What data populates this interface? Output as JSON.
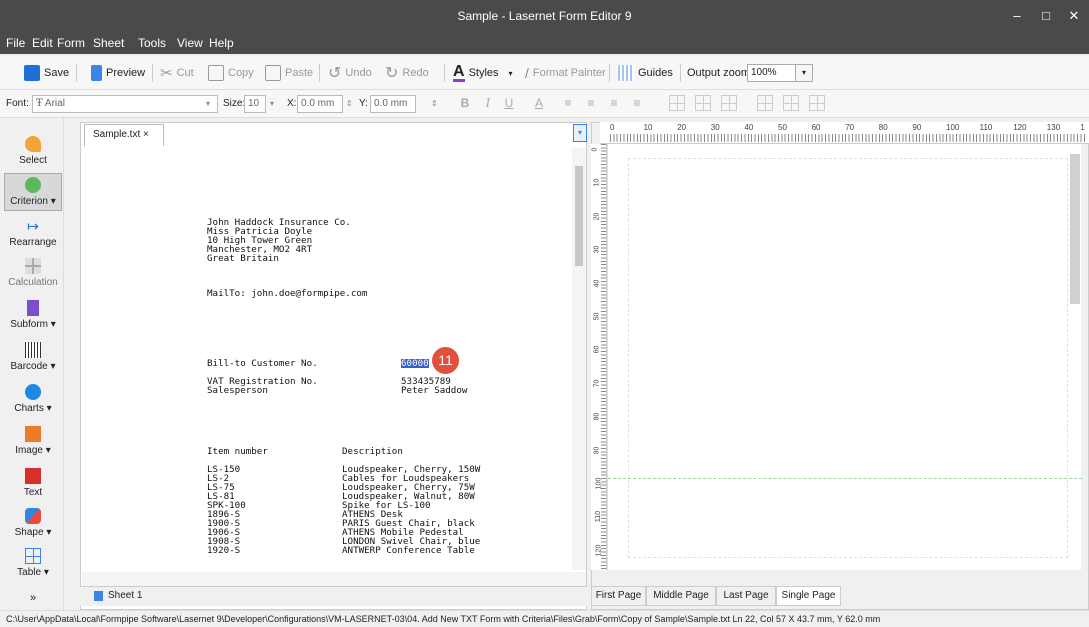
{
  "window": {
    "title": "Sample - Lasernet Form Editor 9",
    "minimize": "–",
    "maximize": "□",
    "close": "✕"
  },
  "menu": [
    "File",
    "Edit",
    "Form",
    "Sheet",
    "Tools",
    "View",
    "Help"
  ],
  "toolbar": {
    "save": "Save",
    "preview": "Preview",
    "cut": "Cut",
    "copy": "Copy",
    "paste": "Paste",
    "undo": "Undo",
    "redo": "Redo",
    "styles": "Styles",
    "format_painter": "Format Painter",
    "guides": "Guides",
    "zoom_label": "Output zoom:",
    "zoom_value": "100%"
  },
  "format_bar": {
    "font_label": "Font:",
    "font_value": "Arial",
    "size_label": "Size:",
    "size_value": "10",
    "x_label": "X:",
    "x_value": "0.0 mm",
    "y_label": "Y:",
    "y_value": "0.0 mm",
    "bold": "B",
    "italic": "I",
    "underline": "U"
  },
  "tools": [
    "Select",
    "Criterion",
    "Rearrange",
    "Calculation",
    "Subform",
    "Barcode",
    "Charts",
    "Image",
    "Text",
    "Shape",
    "Table"
  ],
  "tab": {
    "label": "Sample.txt ×"
  },
  "document": {
    "address": [
      "John Haddock Insurance Co.",
      "Miss Patricia Doyle",
      "10 High Tower Green",
      "Manchester, MO2 4RT",
      "Great Britain"
    ],
    "mailto": "MailTo: john.doe@formpipe.com",
    "billto_label": "Bill-to Customer No.",
    "billto_value": "60000",
    "vat_label": "VAT Registration No.",
    "vat_value": "533435789",
    "sales_label": "Salesperson",
    "sales_value": "Peter Saddow",
    "col_item": "Item number",
    "col_desc": "Description",
    "items": [
      {
        "no": "LS-150",
        "desc": "Loudspeaker, Cherry, 150W"
      },
      {
        "no": "LS-2",
        "desc": "Cables for Loudspeakers"
      },
      {
        "no": "LS-75",
        "desc": "Loudspeaker, Cherry, 75W"
      },
      {
        "no": "LS-81",
        "desc": "Loudspeaker, Walnut, 80W"
      },
      {
        "no": "SPK-100",
        "desc": "Spike for LS-100"
      },
      {
        "no": "1896-S",
        "desc": "ATHENS Desk"
      },
      {
        "no": "1900-S",
        "desc": "PARIS Guest Chair, black"
      },
      {
        "no": "1906-S",
        "desc": "ATHENS Mobile Pedestal"
      },
      {
        "no": "1908-S",
        "desc": "LONDON Swivel Chair, blue"
      },
      {
        "no": "1920-S",
        "desc": "ANTWERP Conference Table"
      }
    ]
  },
  "badge": "11",
  "ruler_h": [
    "0",
    "10",
    "20",
    "30",
    "40",
    "50",
    "60",
    "70",
    "80",
    "90",
    "100",
    "110",
    "120",
    "130",
    "1"
  ],
  "ruler_v": [
    "0",
    "10",
    "20",
    "30",
    "40",
    "50",
    "60",
    "70",
    "80",
    "90",
    "100",
    "110",
    "120"
  ],
  "sheet_tab": "Sheet 1",
  "page_buttons": [
    "First Page",
    "Middle Page",
    "Last Page",
    "Single Page"
  ],
  "status": "C:\\User\\AppData\\Local\\Formpipe Software\\Lasernet 9\\Developer\\Configurations\\VM-LASERNET-03\\04. Add New TXT Form with Criteria\\Files\\Grab\\Form\\Copy of Sample\\Sample.txt   Ln 22, Col 57   X 43.7 mm, Y 62.0 mm",
  "colors": {
    "titlebar": "#4a4a4a",
    "accent": "#1e6fd6",
    "badge": "#e0503a"
  }
}
